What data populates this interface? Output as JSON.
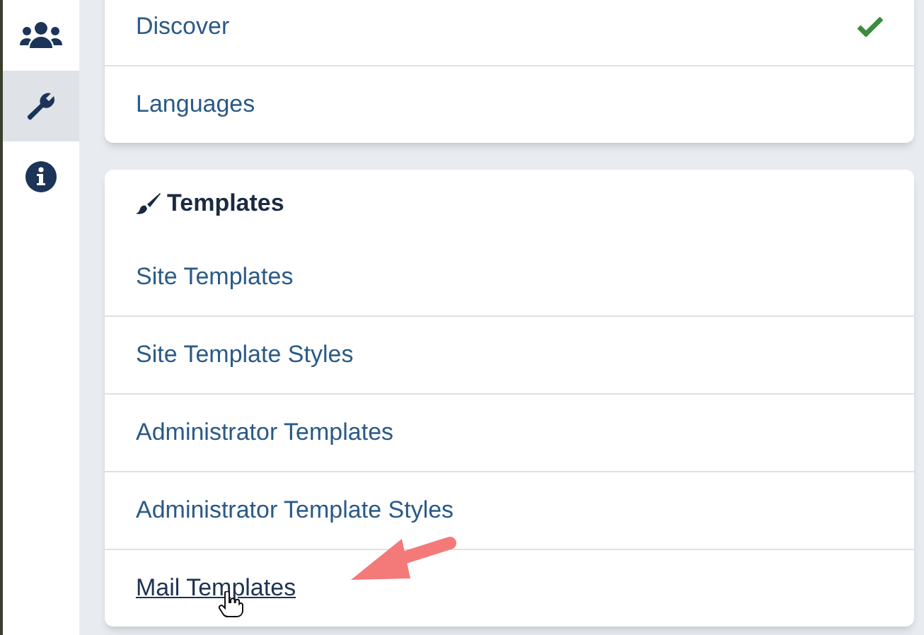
{
  "sidebar": {
    "items": [
      {
        "kind": "users",
        "selected": false
      },
      {
        "kind": "wrench",
        "selected": true
      },
      {
        "kind": "info",
        "selected": false
      }
    ]
  },
  "extensions_card": {
    "items": [
      {
        "label": "Discover",
        "checked": true
      },
      {
        "label": "Languages",
        "checked": false
      }
    ]
  },
  "templates_card": {
    "title": "Templates",
    "items": [
      {
        "label": "Site Templates",
        "hovered": false
      },
      {
        "label": "Site Template Styles",
        "hovered": false
      },
      {
        "label": "Administrator Templates",
        "hovered": false
      },
      {
        "label": "Administrator Template Styles",
        "hovered": false
      },
      {
        "label": "Mail Templates",
        "hovered": true
      }
    ]
  }
}
